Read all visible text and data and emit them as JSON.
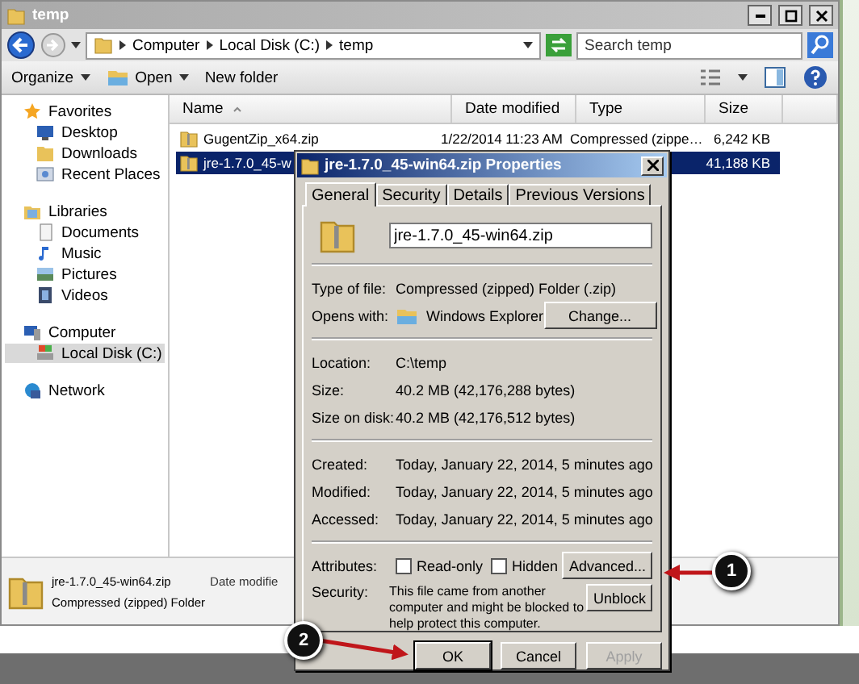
{
  "explorer": {
    "title": "temp",
    "address": [
      "Computer",
      "Local Disk (C:)",
      "temp"
    ],
    "search": {
      "placeholder": "Search temp"
    },
    "toolbar": [
      {
        "label": "Organize",
        "kind": "menu"
      },
      {
        "label": "Open",
        "kind": "open"
      },
      {
        "label": "New folder",
        "kind": "plain"
      }
    ],
    "sidebar": [
      {
        "label": "Favorites",
        "children": [
          {
            "label": "Desktop",
            "selected": false
          },
          {
            "label": "Downloads",
            "selected": false
          },
          {
            "label": "Recent Places",
            "selected": false
          }
        ]
      },
      {
        "label": "Libraries",
        "children": [
          {
            "label": "Documents",
            "selected": false
          },
          {
            "label": "Music",
            "selected": false
          },
          {
            "label": "Pictures",
            "selected": false
          },
          {
            "label": "Videos",
            "selected": false
          }
        ]
      },
      {
        "label": "Computer",
        "children": [
          {
            "label": "Local Disk (C:)",
            "selected": true
          }
        ]
      },
      {
        "label": "Network"
      }
    ],
    "columns": [
      "Name",
      "Date modified",
      "Type",
      "Size"
    ],
    "rows": [
      {
        "name": "GugentZip_x64.zip",
        "date": "1/22/2014 11:23 AM",
        "type": "Compressed (zippe…",
        "size": "6,242 KB",
        "selected": false
      },
      {
        "name": "jre-1.7.0_45-w",
        "size": "41,188 KB",
        "selected": true
      }
    ],
    "details": {
      "name": "jre-1.7.0_45-win64.zip",
      "type": "Compressed (zipped) Folder",
      "label": "Date modifie"
    }
  },
  "dialog": {
    "title": "jre-1.7.0_45-win64.zip Properties",
    "tabs": [
      {
        "label": "General",
        "selected": true
      },
      {
        "label": "Security",
        "selected": false
      },
      {
        "label": "Details",
        "selected": false
      },
      {
        "label": "Previous Versions",
        "selected": false
      }
    ],
    "name_value": "jre-1.7.0_45-win64.zip",
    "sections": [
      [
        {
          "label": "Type of file:",
          "value": "Compressed (zipped) Folder (.zip)",
          "kind": "text"
        },
        {
          "label": "Opens with:",
          "value": "Windows Explorer",
          "button": "Change...",
          "kind": "app"
        }
      ],
      [
        {
          "label": "Location:",
          "value": "C:\\temp",
          "kind": "text"
        },
        {
          "label": "Size:",
          "value": "40.2 MB (42,176,288 bytes)",
          "kind": "text"
        },
        {
          "label": "Size on disk:",
          "value": "40.2 MB (42,176,512 bytes)",
          "kind": "text"
        }
      ],
      [
        {
          "label": "Created:",
          "value": "Today, January 22, 2014, 5 minutes ago",
          "kind": "text"
        },
        {
          "label": "Modified:",
          "value": "Today, January 22, 2014, 5 minutes ago",
          "kind": "text"
        },
        {
          "label": "Accessed:",
          "value": "Today, January 22, 2014, 5 minutes ago",
          "kind": "text"
        }
      ]
    ],
    "attributes": {
      "label": "Attributes:",
      "checkboxes": [
        {
          "label": "Read-only",
          "checked": false
        },
        {
          "label": "Hidden",
          "checked": false
        }
      ],
      "button": "Advanced..."
    },
    "security": {
      "label": "Security:",
      "text": "This file came from another computer and might be blocked to help protect this computer.",
      "button": "Unblock"
    },
    "buttons": [
      {
        "label": "OK",
        "default": true,
        "disabled": false
      },
      {
        "label": "Cancel",
        "default": false,
        "disabled": false
      },
      {
        "label": "Apply",
        "default": false,
        "disabled": true
      }
    ]
  },
  "annotations": [
    {
      "label": "1"
    },
    {
      "label": "2"
    }
  ]
}
